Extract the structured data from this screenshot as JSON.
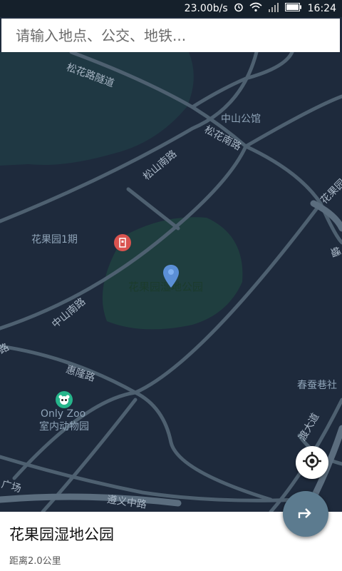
{
  "status_bar": {
    "speed": "23.00b/s",
    "time": "16:24",
    "icons": [
      "alarm-icon",
      "wifi-icon",
      "signal-icon",
      "battery-icon"
    ]
  },
  "search": {
    "placeholder": "请输入地点、公交、地铁..."
  },
  "map": {
    "labels": {
      "songhua_tunnel": "松花路隧道",
      "zhongshan_hall": "中山公馆",
      "songhua_south": "松花南路",
      "songshan_south": "松山南路",
      "huaguo_right": "花果园",
      "huaguo_phase1": "花果园1期",
      "park_name": "花果园湿地公园",
      "zhongshan_south": "中山南路",
      "huilong_road": "惠隆路",
      "only_zoo": "Only Zoo",
      "indoor_zoo": "室内动物园",
      "chuncan_lane": "春蚕巷社",
      "zunyi_road": "遵义中路",
      "left_edge_a": "路",
      "left_edge_b": "广场",
      "right_edge_top": "蟠",
      "right_edge_bottom": "渡大道"
    },
    "colors": {
      "background": "#1e2a3c",
      "water": "#1f3843",
      "park": "#1f3e3f",
      "road": "#4e6070",
      "major_road": "#5b6d7e",
      "pin": "#5b8fd6",
      "hospital_poi": "#d9534f",
      "zoo_poi": "#26b58b"
    }
  },
  "controls": {
    "locate_icon": "crosshair-icon",
    "route_icon": "route-arrow-icon"
  },
  "place": {
    "name": "花果园湿地公园",
    "distance": "距离2.0公里"
  }
}
